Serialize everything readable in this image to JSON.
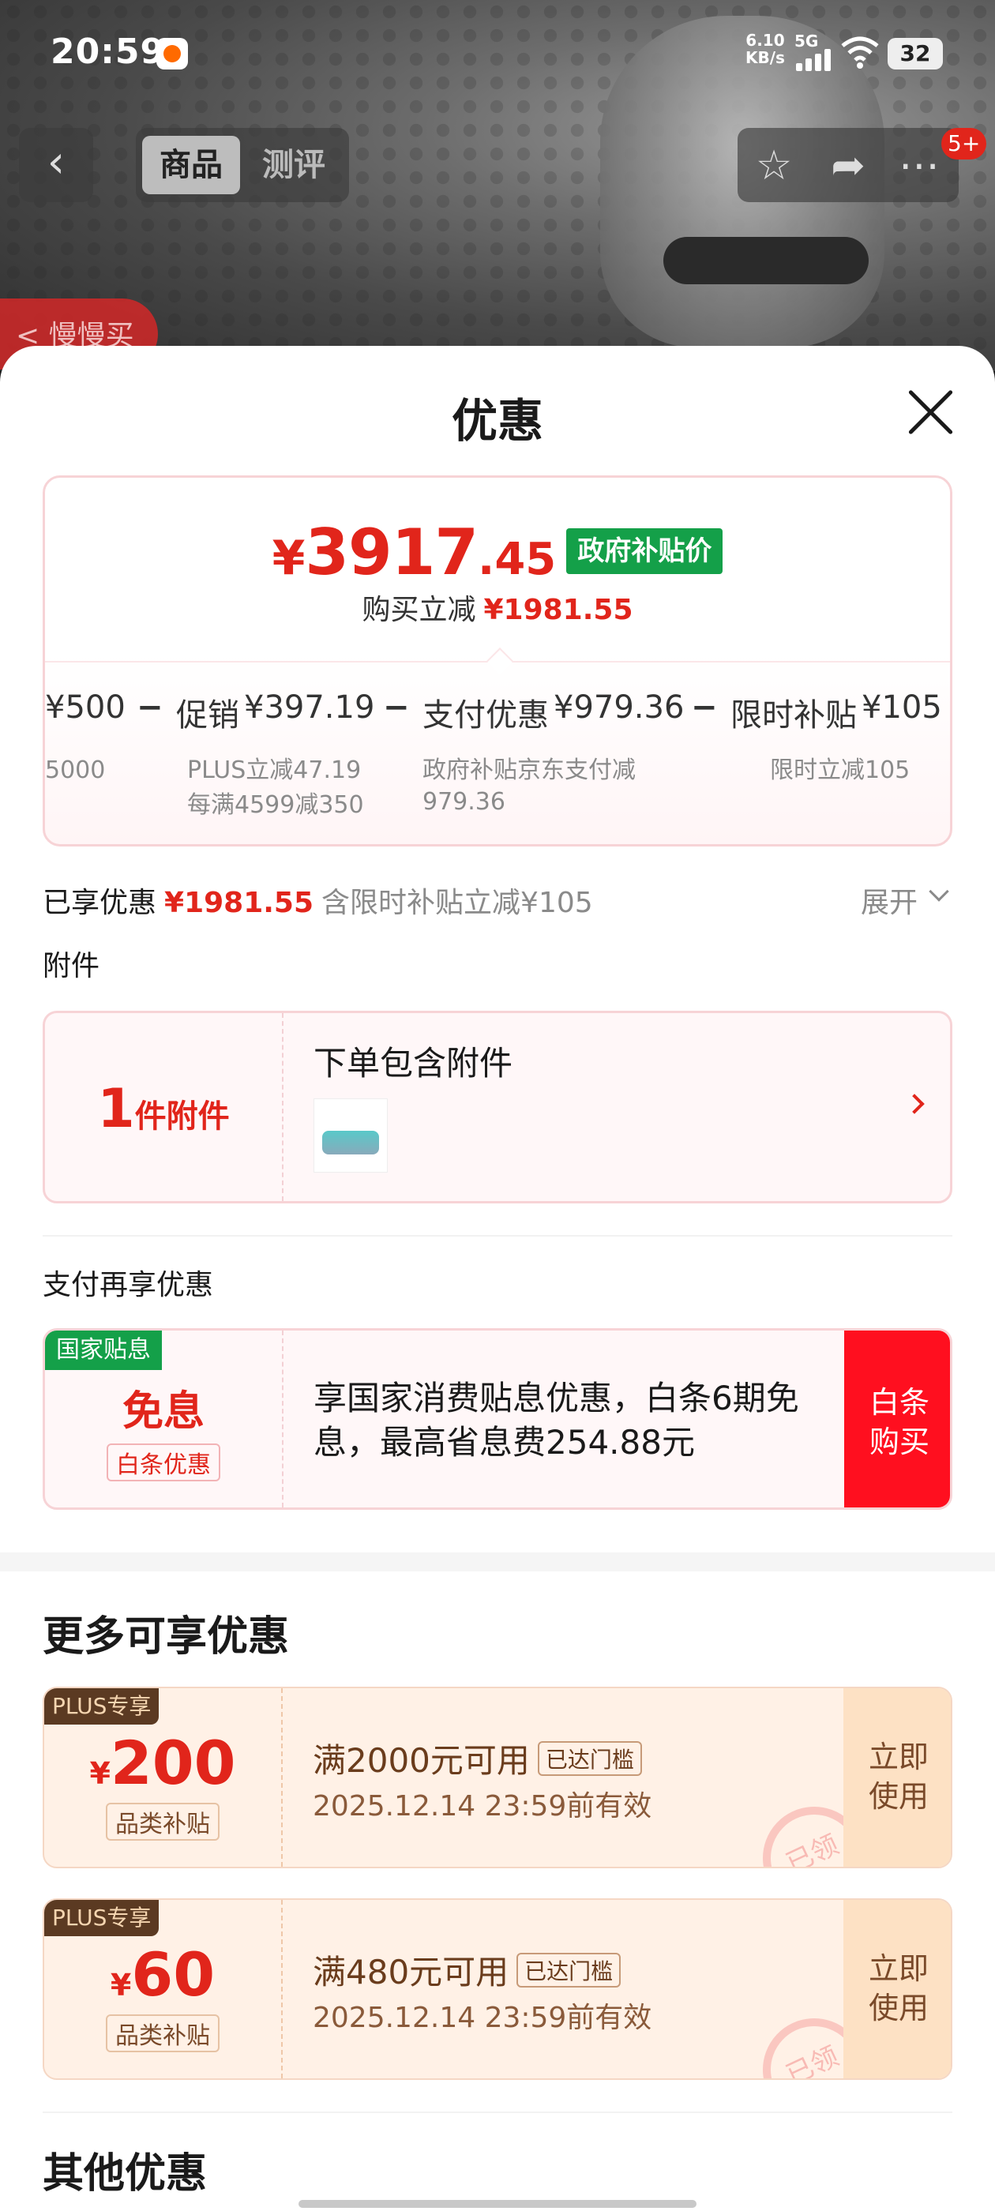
{
  "status_bar": {
    "time": "20:59",
    "net_speed_value": "6.10",
    "net_speed_unit": "KB/s",
    "network": "5G",
    "battery": "32"
  },
  "nav": {
    "tab_product": "商品",
    "tab_review": "测评",
    "badge": "5+",
    "slow_buy": "< 慢慢买"
  },
  "sheet": {
    "title": "优惠"
  },
  "price_summary": {
    "symbol": "¥",
    "price_int": "3917",
    "price_dec": ".45",
    "gov_tag": "政府补贴价",
    "reduce_label": "购买立减",
    "reduce_value": "¥1981.55",
    "formula": {
      "item1": "¥500",
      "minus": "−",
      "item2_label": "促销",
      "item2_value": "¥397.19",
      "item3_label": "支付优惠",
      "item3_value": "¥979.36",
      "item4_label": "限时补贴",
      "item4_value": "¥105"
    },
    "sub1": "5000",
    "sub2_a": "PLUS立减47.19",
    "sub2_b": "每满4599减350",
    "sub3_a": "政府补贴京东支付减",
    "sub3_b": "979.36",
    "sub4": "限时立减105"
  },
  "enjoyed": {
    "label": "已享优惠",
    "value": "¥1981.55",
    "note": "含限时补贴立减¥105",
    "expand": "展开"
  },
  "accessory": {
    "section": "附件",
    "count": "1",
    "count_unit": "件附件",
    "title": "下单包含附件"
  },
  "payment": {
    "section": "支付再享优惠",
    "tag": "国家贴息",
    "free": "免息",
    "sub": "白条优惠",
    "desc": "享国家消费贴息优惠，白条6期免息，最高省息费254.88元",
    "btn_line1": "白条",
    "btn_line2": "购买"
  },
  "more": {
    "title": "更多可享优惠",
    "coupons": [
      {
        "tag": "PLUS专享",
        "yen": "¥",
        "amount": "200",
        "sub": "品类补贴",
        "title": "满2000元可用",
        "badge": "已达门槛",
        "date": "2025.12.14 23:59前有效",
        "btn_line1": "立即",
        "btn_line2": "使用",
        "stamp": "已领"
      },
      {
        "tag": "PLUS专享",
        "yen": "¥",
        "amount": "60",
        "sub": "品类补贴",
        "title": "满480元可用",
        "badge": "已达门槛",
        "date": "2025.12.14 23:59前有效",
        "btn_line1": "立即",
        "btn_line2": "使用",
        "stamp": "已领"
      }
    ]
  },
  "other": {
    "title": "其他优惠"
  },
  "colors": {
    "accent_red": "#e1251b",
    "gov_green": "#14a049",
    "coupon_bg": "#fff1e6",
    "plus_brown": "#5b3a22"
  }
}
